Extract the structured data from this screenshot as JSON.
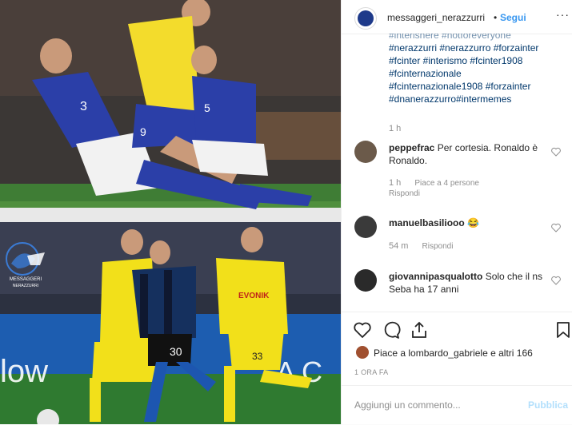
{
  "post": {
    "username": "messaggeri_nerazzurri",
    "separator": "•",
    "follow_label": "Segui",
    "more_label": "···",
    "watermark_line1": "MESSAGGERI",
    "watermark_line2": "NERAZZURRI",
    "caption_lines": [
      "#interisnere #notforeveryone",
      "#nerazzurri #nerazzurro #forzainter",
      "#fcinter #interismo #fcinter1908",
      "#fcinternazionale",
      "#fcinternazionale1908 #forzainter",
      "#dnanerazzurro#intermemes"
    ],
    "caption_time": "1 h"
  },
  "comments": [
    {
      "user": "peppefrac",
      "text": "Per cortesia. Ronaldo è Ronaldo.",
      "time": "1 h",
      "likes": "Piace a 4 persone",
      "reply": "Rispondi"
    },
    {
      "user": "manuelbasiliooo",
      "text": "😂",
      "time": "54 m",
      "reply": "Rispondi"
    },
    {
      "user": "giovannipasqualotto",
      "text": "Solo che il ns Seba ha 17 anni"
    }
  ],
  "actions": {
    "likes_text": "Piace a lombardo_gabriele e altri 166",
    "date": "1 ORA FA"
  },
  "compose": {
    "placeholder": "Aggiungi un commento...",
    "publish_label": "Pubblica"
  }
}
